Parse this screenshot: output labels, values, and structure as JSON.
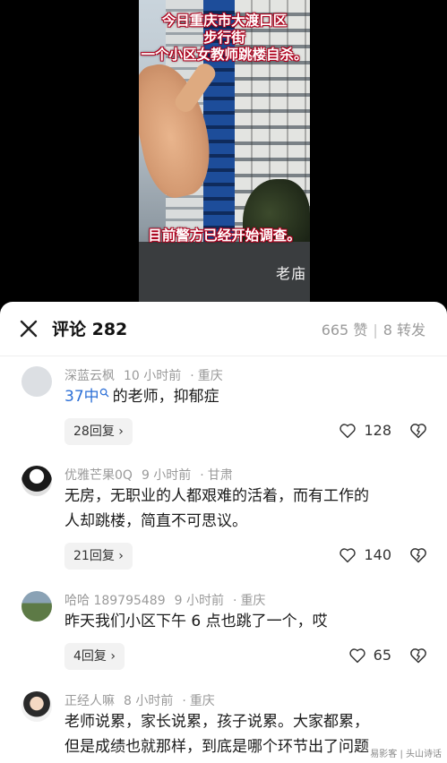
{
  "video": {
    "caption_top_lines": [
      "今日重庆市大渡口区",
      "步行街",
      "一个小区女教师跳楼自杀。"
    ],
    "caption_bottom": "目前警方已经开始调查。",
    "sign_text": "老庙"
  },
  "header": {
    "title": "评论 282",
    "likes": "665 赞",
    "separator": "|",
    "shares": "8 转发"
  },
  "comments": [
    {
      "user": "深蓝云枫",
      "time": "10 小时前",
      "location": "重庆",
      "text_highlight": "37中",
      "text": "的老师，抑郁症",
      "replies": "28回复",
      "likes": "128"
    },
    {
      "user": "优雅芒果0Q",
      "time": "9 小时前",
      "location": "甘肃",
      "text_line1": "无房，无职业的人都艰难的活着，而有工作的",
      "text_line2": "人却跳楼，简直不可思议。",
      "replies": "21回复",
      "likes": "140"
    },
    {
      "user": "哈哈 189795489",
      "time": "9 小时前",
      "location": "重庆",
      "text": "昨天我们小区下午 6 点也跳了一个，哎",
      "replies": "4回复",
      "likes": "65"
    },
    {
      "user": "正经人嘛",
      "time": "8 小时前",
      "location": "重庆",
      "text_line1": "老师说累，家长说累，孩子说累。大家都累，",
      "text_line2": "但是成绩也就那样，到底是哪个环节出了问题"
    }
  ],
  "separator_dot": "·",
  "watermark": "易影客 | 头山诗话"
}
